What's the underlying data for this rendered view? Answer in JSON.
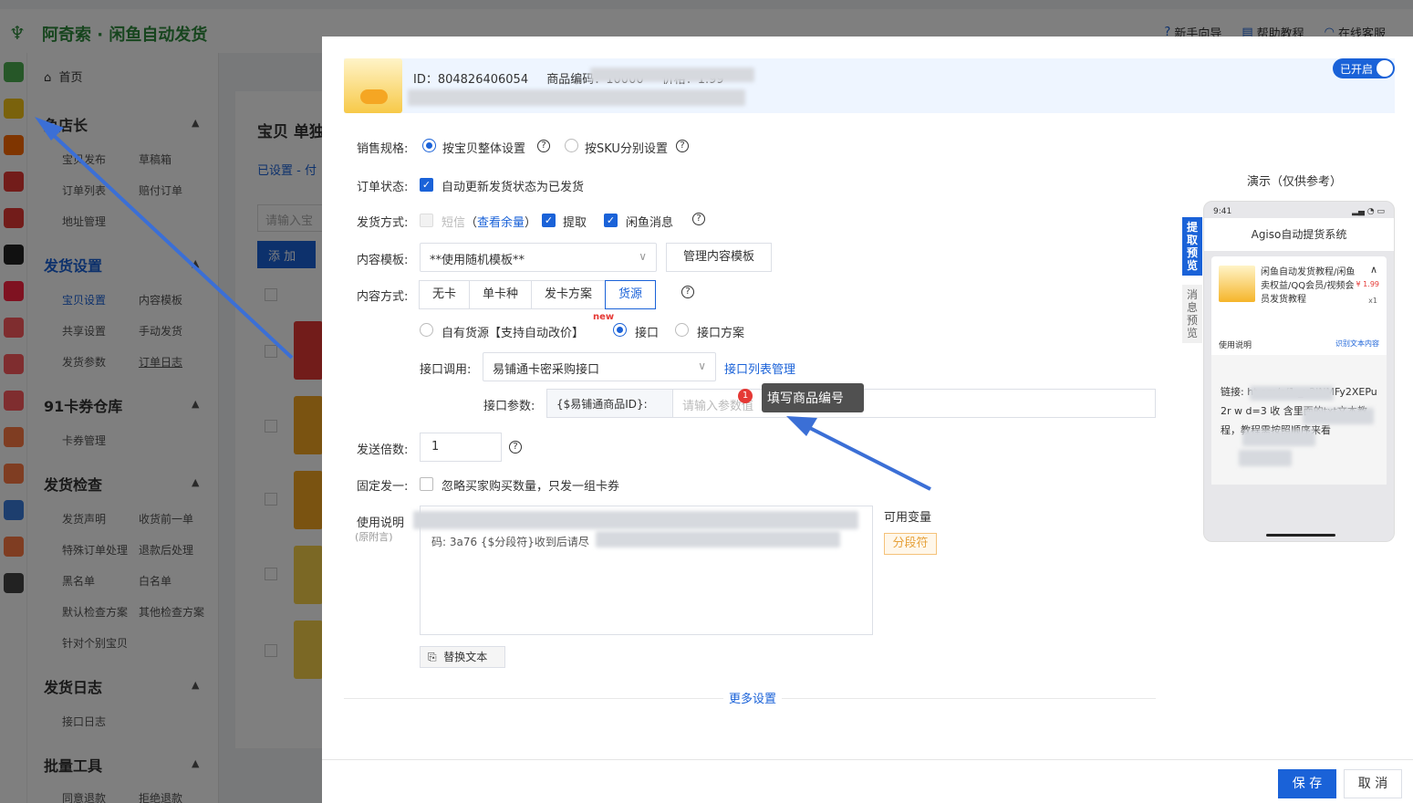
{
  "app": {
    "logo_text": "阿奇索 · 闲鱼自动发货",
    "top_links": [
      {
        "icon": "help-circle-icon",
        "label": "新手向导"
      },
      {
        "icon": "document-icon",
        "label": "帮助教程"
      },
      {
        "icon": "headset-icon",
        "label": "在线客服"
      }
    ]
  },
  "sidebar": {
    "home": "首页",
    "sections": [
      {
        "title": "鱼店长",
        "items": [
          "宝贝发布",
          "草稿箱",
          "订单列表",
          "赔付订单",
          "地址管理"
        ]
      },
      {
        "title": "发货设置",
        "items": [
          "宝贝设置",
          "内容模板",
          "共享设置",
          "手动发货",
          "发货参数",
          "订单日志"
        ]
      },
      {
        "title": "91卡券仓库",
        "items": [
          "卡券管理"
        ]
      },
      {
        "title": "发货检查",
        "items": [
          "发货声明",
          "收货前一单",
          "特殊订单处理",
          "退款后处理",
          "黑名单",
          "白名单",
          "默认检查方案",
          "其他检查方案",
          "针对个别宝贝"
        ]
      },
      {
        "title": "发货日志",
        "items": [
          "接口日志"
        ]
      },
      {
        "title": "批量工具",
        "items": [
          "同意退款",
          "拒绝退款"
        ]
      }
    ]
  },
  "bg_main": {
    "tab": "宝贝  单独",
    "subtab": "已设置 - 付",
    "search_placeholder": "请输入宝",
    "add_button": "添 加"
  },
  "product": {
    "id_text": "ID：804826406054",
    "code_text": "商品编码：10000",
    "price_text": "价格：1.99",
    "enabled_label": "已开启"
  },
  "form": {
    "sales_spec": {
      "label": "销售规格:",
      "opt1": "按宝贝整体设置",
      "opt2": "按SKU分别设置"
    },
    "order_status": {
      "label": "订单状态:",
      "checkbox": "自动更新发货状态为已发货"
    },
    "ship_method": {
      "label": "发货方式:",
      "sms": "短信",
      "sms_link": "查看余量",
      "pickup": "提取",
      "xianyu": "闲鱼消息"
    },
    "content_template": {
      "label": "内容模板:",
      "value": "**使用随机模板**",
      "manage_button": "管理内容模板"
    },
    "content_method": {
      "label": "内容方式:",
      "options": [
        "无卡",
        "单卡种",
        "发卡方案",
        "货源"
      ],
      "selected": "货源"
    },
    "source": {
      "opt1": "自有货源【支持自动改价】",
      "new_tag": "new",
      "opt2": "接口",
      "opt3": "接口方案"
    },
    "api_call": {
      "label": "接口调用:",
      "value": "易铺通卡密采购接口",
      "manage_link": "接口列表管理"
    },
    "api_param": {
      "label": "接口参数:",
      "prefix": "{$易铺通商品ID}:",
      "placeholder": "请输入参数值"
    },
    "tooltip": {
      "badge": "1",
      "text": "填写商品编号"
    },
    "multiplier": {
      "label": "发送倍数:",
      "value": "1"
    },
    "fixed_one": {
      "label": "固定发一:",
      "checkbox": "忽略买家购买数量，只发一组卡券"
    },
    "usage": {
      "label": "使用说明",
      "sublabel": "(原附言)",
      "text": "码: 3a76 {$分段符}收到后请尽"
    },
    "variables": {
      "label": "可用变量",
      "tag": "分段符"
    },
    "replace_button": "替换文本",
    "more_settings": "更多设置"
  },
  "footer": {
    "save": "保 存",
    "cancel": "取 消"
  },
  "preview": {
    "title": "演示（仅供参考）",
    "tab_pickup": "提取预览",
    "tab_message": "消息预览",
    "status_time": "9:41",
    "header": "Agiso自动提货系统",
    "item_title": "闲鱼自动发货教程/闲鱼卖权益/QQ会员/视频会员发货教程",
    "item_price": "¥ 1.99",
    "item_qty": "x1",
    "usage_label": "使用说明",
    "copy_link": "识别文本内容",
    "body_text": "链接: ht             om/s/1 _v2INMFy2XEPu2r         w d=3       收      含里面的txt文本教程，教程需按照顺序来看"
  },
  "colors": {
    "accent": "#1a62d8",
    "brand_green": "#2e8b3d",
    "annotation_arrow": "#3b6fd6",
    "tooltip_bg": "#505050",
    "badge_red": "#e53935"
  }
}
